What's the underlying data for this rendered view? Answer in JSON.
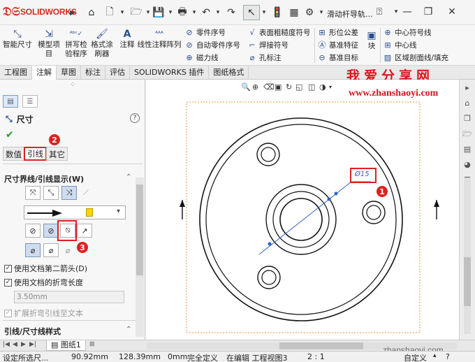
{
  "app": {
    "name": "SOLIDWORKS",
    "filename": "滑动杆导轨..."
  },
  "ribbon": {
    "smart_dimension": "智能尺寸",
    "model_items_l1": "模型项",
    "model_items_l2": "目",
    "spell_l1": "拼写检",
    "spell_l2": "验程序",
    "format_l1": "格式涂",
    "format_l2": "刷器",
    "note": "注释",
    "linear_pattern": "线性注释阵列",
    "balloon": "零件序号",
    "auto_balloon": "自动零件序号",
    "magnetic_line": "磁力线",
    "surface_finish": "表面粗糙度符号",
    "weld_symbol": "焊接符号",
    "hole_callout": "孔标注",
    "gtol": "形位公差",
    "datum_feature": "基准特征",
    "datum_target": "基准目标",
    "block": "块",
    "center_mark": "中心符号线",
    "centerline": "中心线",
    "area_hatch": "区域剖面线/填充"
  },
  "tabs": [
    "工程图",
    "注解",
    "草图",
    "标注",
    "评估",
    "SOLIDWORKS 插件",
    "图纸格式"
  ],
  "active_tab_index": 1,
  "watermark": {
    "cn": "我爱分享网",
    "url": "www.zhanshaoyi.com",
    "url_bottom": "zhanshaoyi.com"
  },
  "panel": {
    "title": "尺寸",
    "subtabs": [
      "数值",
      "引线",
      "其它"
    ],
    "active_subtab_index": 1,
    "section_title": "尺寸界线/引线显示(W)",
    "checkbox1": "使用文档第二箭头(D)",
    "checkbox2": "使用文档的折弯长度",
    "bend_length": "3.50mm",
    "checkbox3": "扩展折弯引线至文本",
    "section2_title": "引线/尺寸线样式",
    "callouts": [
      "1",
      "2",
      "3"
    ]
  },
  "drawing": {
    "dimension_text": "Ø15"
  },
  "sheet": {
    "tab_label": "图纸1"
  },
  "status": {
    "message": "设定所选尺...",
    "x": "90.92mm",
    "y": "128.39mm",
    "z": "0mm",
    "state": "完全定义",
    "editing": "在编辑 工程视图3",
    "scale": "2 : 1",
    "custom": "自定义"
  },
  "colors": {
    "brand": "#d52b1e",
    "callout": "#e02020",
    "selection": "#2a64c5",
    "border_dashed": "#e89a3c"
  }
}
